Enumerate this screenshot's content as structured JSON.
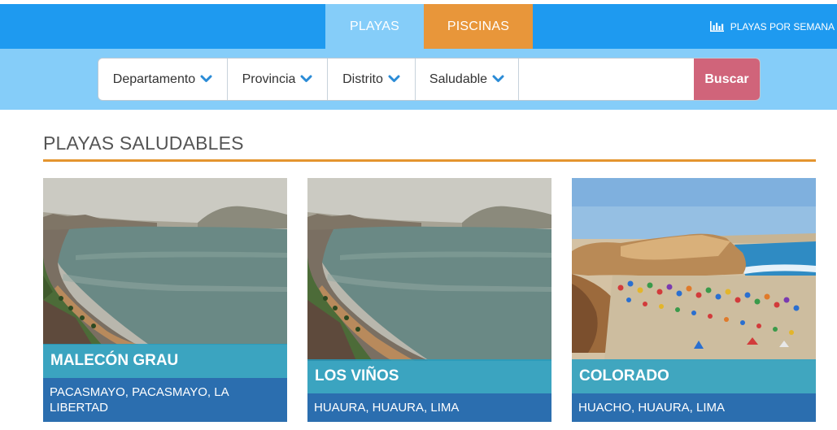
{
  "nav": {
    "tabs": [
      {
        "label": "PLAYAS",
        "active": true
      },
      {
        "label": "PISCINAS",
        "active": false
      }
    ],
    "weekly_link": "PLAYAS POR SEMANA",
    "weekly_icon": "bar-chart-icon"
  },
  "filters": {
    "departamento": "Departamento",
    "provincia": "Provincia",
    "distrito": "Distrito",
    "saludable": "Saludable",
    "search_value": "",
    "search_button": "Buscar"
  },
  "section": {
    "title": "PLAYAS SALUDABLES"
  },
  "cards": [
    {
      "name": "MALECÓN GRAU",
      "location": "PACASMAYO, PACASMAYO, LA LIBERTAD",
      "image": "coastal-bay-photo"
    },
    {
      "name": "LOS VIÑOS",
      "location": "HUAURA, HUAURA, LIMA",
      "image": "coastal-bay-photo"
    },
    {
      "name": "COLORADO",
      "location": "HUACHO, HUAURA, LIMA",
      "image": "crowded-beach-photo"
    }
  ],
  "colors": {
    "nav_blue": "#1e9af0",
    "light_blue": "#85cdf9",
    "orange": "#e8963a",
    "buscar_pink": "#d0647a",
    "location_blue": "#2b6eaf",
    "name_teal": "#20a0c4"
  }
}
